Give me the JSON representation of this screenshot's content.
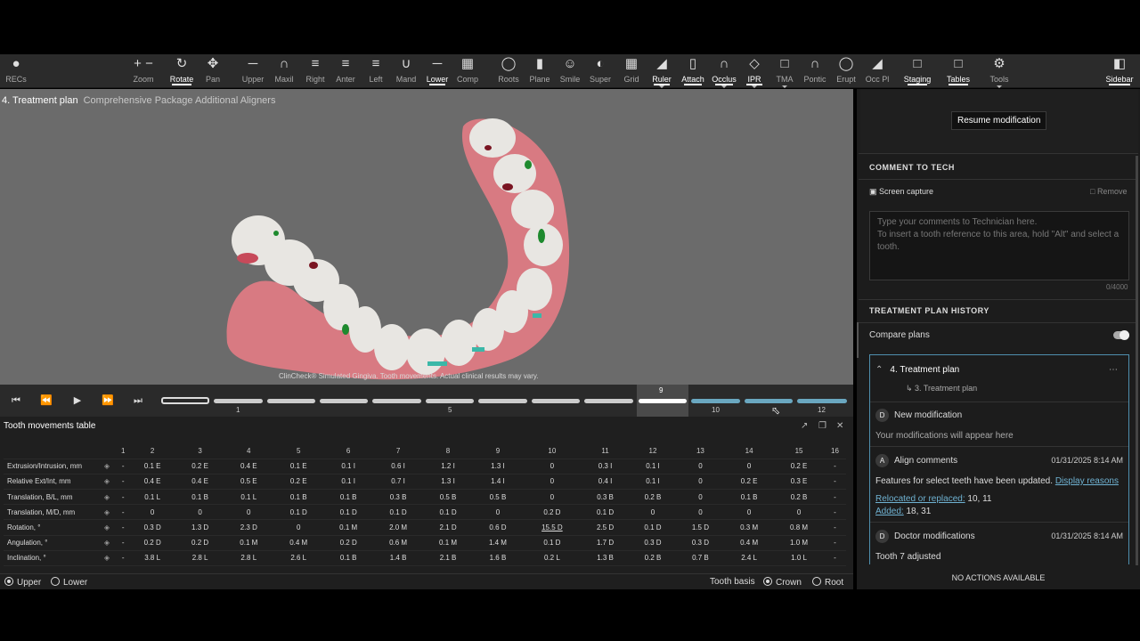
{
  "toolbar": {
    "recs": "RECs",
    "zoom": "Zoom",
    "rotate": "Rotate",
    "pan": "Pan",
    "upper": "Upper",
    "maxil": "Maxil",
    "right": "Right",
    "anter": "Anter",
    "left": "Left",
    "mand": "Mand",
    "lower": "Lower",
    "comp": "Comp",
    "roots": "Roots",
    "plane": "Plane",
    "smile": "Smile",
    "super": "Super",
    "grid": "Grid",
    "ruler": "Ruler",
    "attach": "Attach",
    "occlus": "Occlus",
    "ipr": "IPR",
    "tma": "TMA",
    "pontic": "Pontic",
    "erupt": "Erupt",
    "occpl": "Occ Pl",
    "staging": "Staging",
    "tables": "Tables",
    "tools": "Tools",
    "sidebar": "Sidebar"
  },
  "viewport": {
    "title": "4. Treatment plan",
    "subtitle": "Comprehensive Package Additional Aligners",
    "disclaimer": "ClinCheck® Simulated Gingiva. Tooth movements. Actual clinical results may vary."
  },
  "timeline": {
    "current_stage": "9",
    "label_1": "1",
    "label_5": "5",
    "label_10": "10",
    "label_12": "12"
  },
  "table": {
    "title": "Tooth movements table",
    "columns": [
      "1",
      "2",
      "3",
      "4",
      "5",
      "6",
      "7",
      "8",
      "9",
      "10",
      "11",
      "12",
      "13",
      "14",
      "15",
      "16"
    ],
    "rows": [
      {
        "label": "Extrusion/Intrusion, mm",
        "values": [
          "-",
          "0.1 E",
          "0.2 E",
          "0.4 E",
          "0.1 E",
          "0.1 I",
          "0.6 I",
          "1.2 I",
          "1.3 I",
          "0",
          "0.3 I",
          "0.1 I",
          "0",
          "0",
          "0.2 E",
          "-"
        ]
      },
      {
        "label": "Relative Ext/Int, mm",
        "values": [
          "-",
          "0.4 E",
          "0.4 E",
          "0.5 E",
          "0.2 E",
          "0.1 I",
          "0.7 I",
          "1.3 I",
          "1.4 I",
          "0",
          "0.4 I",
          "0.1 I",
          "0",
          "0.2 E",
          "0.3 E",
          "-"
        ]
      },
      {
        "label": "Translation, B/L, mm",
        "values": [
          "-",
          "0.1 L",
          "0.1 B",
          "0.1 L",
          "0.1 B",
          "0.1 B",
          "0.3 B",
          "0.5 B",
          "0.5 B",
          "0",
          "0.3 B",
          "0.2 B",
          "0",
          "0.1 B",
          "0.2 B",
          "-"
        ]
      },
      {
        "label": "Translation, M/D, mm",
        "values": [
          "-",
          "0",
          "0",
          "0",
          "0.1 D",
          "0.1 D",
          "0.1 D",
          "0.1 D",
          "0",
          "0.2 D",
          "0.1 D",
          "0",
          "0",
          "0",
          "0",
          "-"
        ]
      },
      {
        "label": "Rotation, °",
        "values": [
          "-",
          "0.3 D",
          "1.3 D",
          "2.3 D",
          "0",
          "0.1 M",
          "2.0 M",
          "2.1 D",
          "0.6 D",
          "15.5 D",
          "2.5 D",
          "0.1 D",
          "1.5 D",
          "0.3 M",
          "0.8 M",
          "-"
        ]
      },
      {
        "label": "Angulation, °",
        "values": [
          "-",
          "0.2 D",
          "0.2 D",
          "0.1 M",
          "0.4 M",
          "0.2 D",
          "0.6 M",
          "0.1 M",
          "1.4 M",
          "0.1 D",
          "1.7 D",
          "0.3 D",
          "0.3 D",
          "0.4 M",
          "1.0 M",
          "-"
        ]
      },
      {
        "label": "Inclination, °",
        "values": [
          "-",
          "3.8 L",
          "2.8 L",
          "2.8 L",
          "2.6 L",
          "0.1 B",
          "1.4 B",
          "2.1 B",
          "1.6 B",
          "0.2 L",
          "1.3 B",
          "0.2 B",
          "0.7 B",
          "2.4 L",
          "1.0 L",
          "-"
        ]
      }
    ],
    "arch_upper": "Upper",
    "arch_lower": "Lower",
    "tooth_basis": "Tooth basis",
    "crown": "Crown",
    "root": "Root"
  },
  "sidebar": {
    "resume": "Resume modification",
    "comment_head": "COMMENT TO TECH",
    "screen_capture": "Screen capture",
    "remove": "Remove",
    "comment_placeholder_1": "Type your comments to Technician here.",
    "comment_placeholder_2": "To insert a tooth reference to this area, hold \"Alt\" and select a tooth.",
    "char_count": "0/4000",
    "history_head": "TREATMENT PLAN HISTORY",
    "compare_plans": "Compare plans",
    "card_title": "4. Treatment plan",
    "card_parent": "3. Treatment plan",
    "new_mod_title": "New modification",
    "new_mod_text": "Your modifications will appear here",
    "align_title": "Align comments",
    "align_date": "01/31/2025 8:14 AM",
    "align_text": "Features for select teeth have been updated.",
    "display_reasons": "Display reasons",
    "relocated_label": "Relocated or replaced:",
    "relocated_val": "10, 11",
    "added_label": "Added:",
    "added_val": "18, 31",
    "doctor_title": "Doctor modifications",
    "doctor_date": "01/31/2025 8:14 AM",
    "doctor_text": "Tooth 7 adjusted",
    "no_actions": "NO ACTIONS AVAILABLE",
    "avatar_d": "D",
    "avatar_a": "A"
  }
}
